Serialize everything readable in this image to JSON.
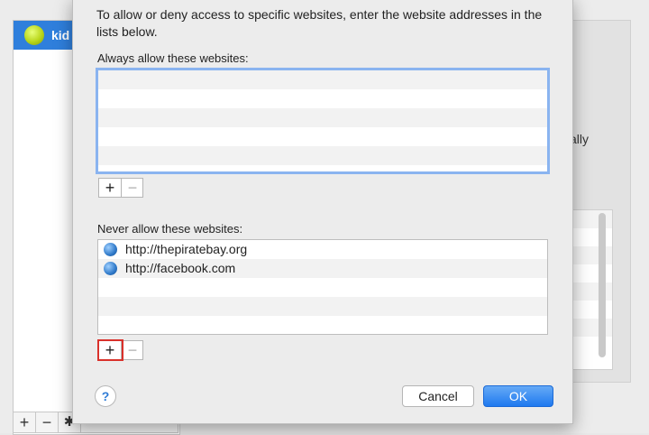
{
  "background": {
    "user_name": "kid a",
    "partial_text": "ally",
    "sidebar_footer": {
      "add": "+",
      "remove": "−",
      "gear_icon": "gear-icon"
    }
  },
  "sheet": {
    "intro": "To allow or deny access to specific websites, enter the website addresses in the lists below.",
    "always_allow": {
      "label": "Always allow these websites:",
      "items": []
    },
    "never_allow": {
      "label": "Never allow these websites:",
      "items": [
        {
          "url": "http://thepiratebay.org"
        },
        {
          "url": "http://facebook.com"
        }
      ]
    },
    "add_symbol": "+",
    "remove_symbol": "−",
    "help_symbol": "?",
    "cancel_label": "Cancel",
    "ok_label": "OK"
  },
  "colors": {
    "accent": "#1e79ef",
    "highlight": "#d9312b"
  }
}
